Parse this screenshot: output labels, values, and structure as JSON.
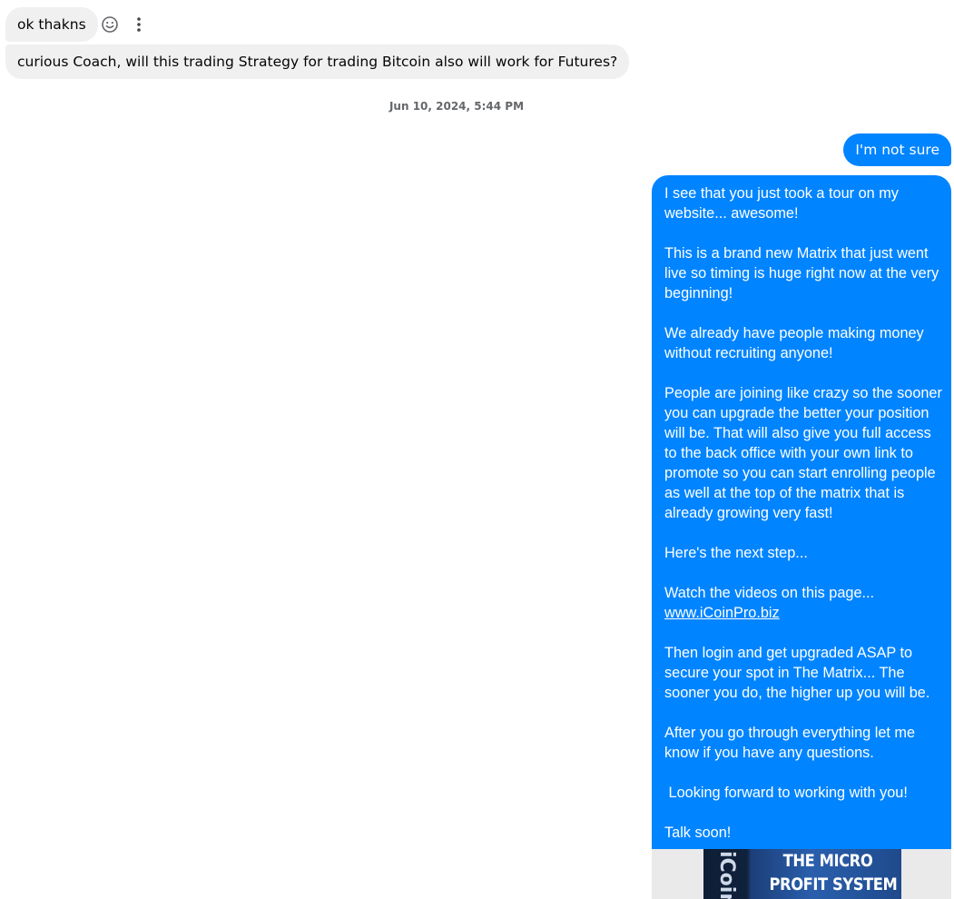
{
  "messages": {
    "incoming": [
      {
        "text": "ok thakns"
      },
      {
        "text": "curious Coach, will this trading Strategy for trading Bitcoin also will work for Futures?"
      }
    ],
    "actions": {
      "react_icon": "smiley-icon",
      "more_icon": "more-vertical-icon"
    },
    "timestamp": "Jun 10, 2024, 5:44 PM",
    "outgoing_short": "I'm not sure",
    "outgoing_long": {
      "p1": "I see that you just took a tour on my website... awesome!",
      "p2": "This is a brand new Matrix that just went live so timing is huge right now at the very beginning!",
      "p3": "We already have people making money without recruiting anyone!",
      "p4": "People are joining like crazy so the sooner you can upgrade the better your position will be.  That will also give you full access to the back office with your own link to promote so you can start enrolling people as well at the top of the matrix that is already growing very fast!",
      "p5": "Here's the next step...",
      "p6": "Watch the videos on this page...",
      "link": "www.iCoinPro.biz",
      "p7": "Then login and get upgraded ASAP to secure your spot in The Matrix... The sooner you do, the higher up you will be.",
      "p8": "After you go through everything let me know if you have any questions.",
      "p9": " Looking forward to working with you!",
      "p10": "Talk soon!"
    },
    "attachment": {
      "spine_text": "iCoin",
      "title_line1": "THE MICRO",
      "title_line2": "PROFIT SYSTEM"
    }
  },
  "colors": {
    "incoming_bubble": "#f0f0f0",
    "outgoing_bubble": "#0084ff",
    "timestamp": "#65676b"
  }
}
